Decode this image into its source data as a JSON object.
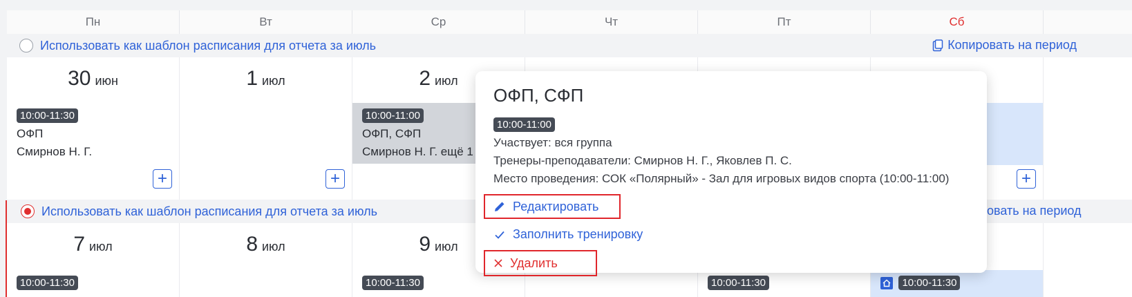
{
  "days": [
    "Пн",
    "Вт",
    "Ср",
    "Чт",
    "Пт",
    "Сб",
    ""
  ],
  "template_label": "Использовать как шаблон расписания для отчета за июль",
  "copy_label": "Копировать на период",
  "copy_label_partial": "овать на период",
  "week1": {
    "dates": [
      {
        "num": "30",
        "mon": "июн"
      },
      {
        "num": "1",
        "mon": "июл"
      },
      {
        "num": "2",
        "mon": "июл"
      }
    ],
    "events": {
      "mon": {
        "time": "10:00-11:30",
        "title": "ОФП",
        "coach": "Смирнов Н. Г."
      },
      "wed": {
        "time": "10:00-11:00",
        "title": "ОФП, СФП",
        "coach": "Смирнов Н. Г. ещё 1"
      }
    }
  },
  "week2": {
    "dates": [
      {
        "num": "7",
        "mon": "июл"
      },
      {
        "num": "8",
        "mon": "июл"
      },
      {
        "num": "9",
        "mon": "июл"
      }
    ],
    "times": {
      "mon": "10:00-11:30",
      "wed": "10:00-11:30",
      "fri": "10:00-11:30",
      "sat": "10:00-11:30"
    }
  },
  "add_symbol": "+",
  "popup": {
    "title": "ОФП, СФП",
    "time": "10:00-11:00",
    "participants": "Участвует: вся группа",
    "coaches": "Тренеры-преподаватели: Смирнов Н. Г., Яковлев П. С.",
    "place": "Место проведения: СОК «Полярный» - Зал для игровых видов спорта (10:00-11:00)",
    "edit": "Редактировать",
    "fill": "Заполнить тренировку",
    "delete": "Удалить"
  },
  "colors": {
    "accent": "#2f62d8",
    "danger": "#e02f2f",
    "badge": "#454b55"
  }
}
